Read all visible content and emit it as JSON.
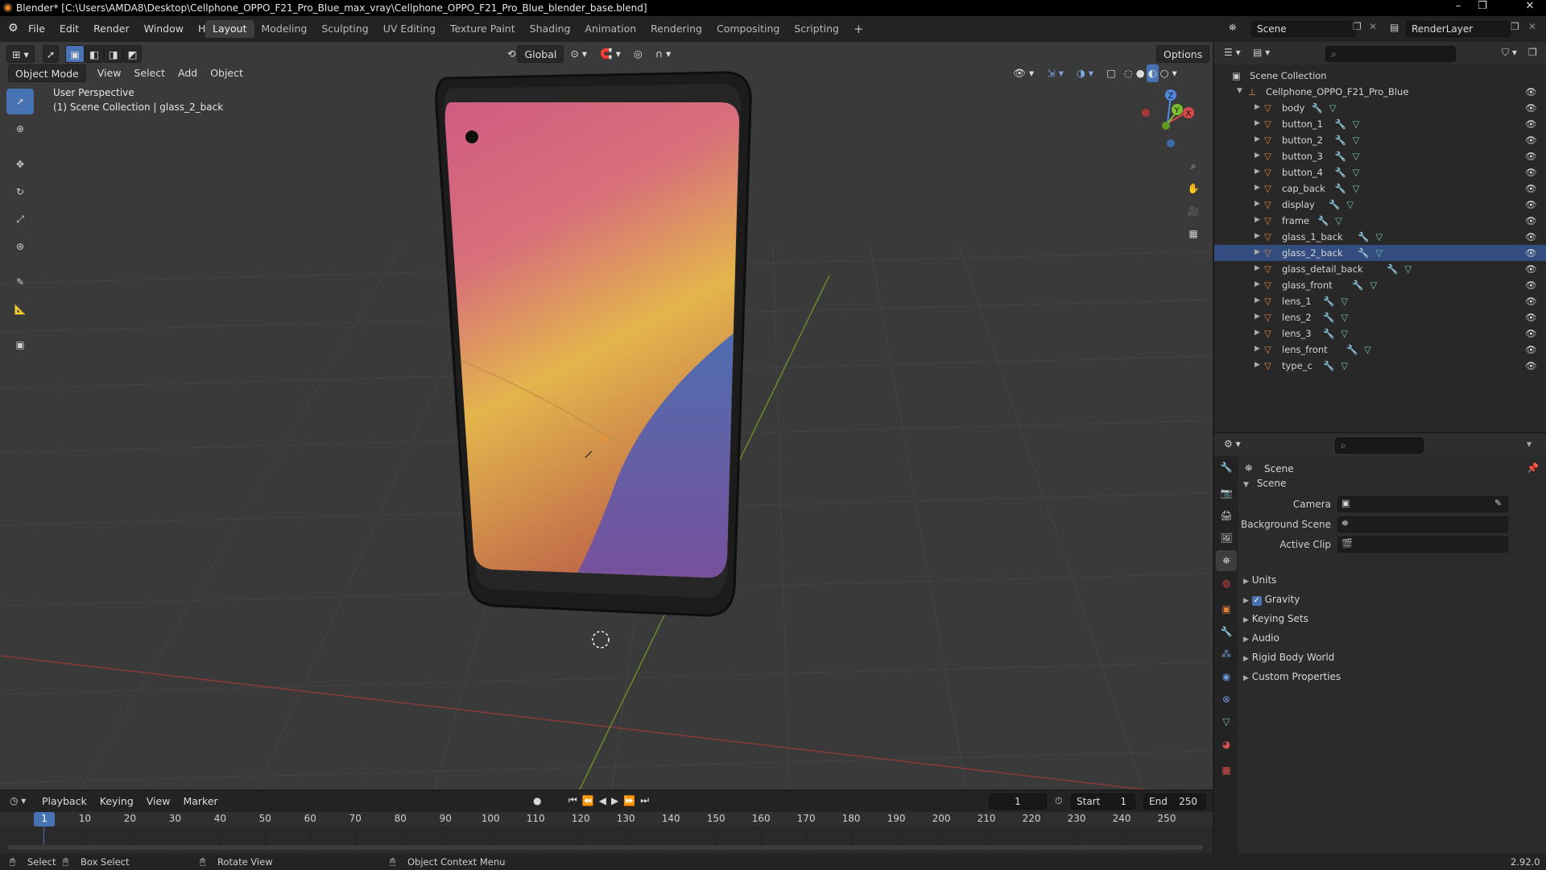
{
  "window": {
    "title": "Blender* [C:\\Users\\AMDA8\\Desktop\\Cellphone_OPPO_F21_Pro_Blue_max_vray\\Cellphone_OPPO_F21_Pro_Blue_blender_base.blend]"
  },
  "menu": [
    "File",
    "Edit",
    "Render",
    "Window",
    "Help"
  ],
  "workspaces": [
    "Layout",
    "Modeling",
    "Sculpting",
    "UV Editing",
    "Texture Paint",
    "Shading",
    "Animation",
    "Rendering",
    "Compositing",
    "Scripting"
  ],
  "scene_selector": {
    "scene": "Scene",
    "view_layer": "RenderLayer"
  },
  "viewport": {
    "mode": "Object Mode",
    "menus": [
      "View",
      "Select",
      "Add",
      "Object"
    ],
    "orientation": "Global",
    "options_label": "Options",
    "info_line1": "User Perspective",
    "info_line2": "(1) Scene Collection | glass_2_back"
  },
  "outliner": {
    "root": "Scene Collection",
    "collection": "Cellphone_OPPO_F21_Pro_Blue",
    "items": [
      "body",
      "button_1",
      "button_2",
      "button_3",
      "button_4",
      "cap_back",
      "display",
      "frame",
      "glass_1_back",
      "glass_2_back",
      "glass_detail_back",
      "glass_front",
      "lens_1",
      "lens_2",
      "lens_3",
      "lens_front",
      "type_c"
    ],
    "selected": "glass_2_back"
  },
  "properties": {
    "context": "Scene",
    "panel": "Scene",
    "camera_label": "Camera",
    "bg_scene_label": "Background Scene",
    "active_clip_label": "Active Clip",
    "subpanels": [
      "Units",
      "Gravity",
      "Keying Sets",
      "Audio",
      "Rigid Body World",
      "Custom Properties"
    ],
    "gravity_enabled": true
  },
  "timeline": {
    "menus": [
      "Playback",
      "Keying",
      "View",
      "Marker"
    ],
    "current_frame": "1",
    "start_label": "Start",
    "start": "1",
    "end_label": "End",
    "end": "250",
    "ticks": [
      "1",
      "10",
      "20",
      "30",
      "40",
      "50",
      "60",
      "70",
      "80",
      "90",
      "100",
      "110",
      "120",
      "130",
      "140",
      "150",
      "160",
      "170",
      "180",
      "190",
      "200",
      "210",
      "220",
      "230",
      "240",
      "250"
    ]
  },
  "status": {
    "select": "Select",
    "box_select": "Box Select",
    "rotate_view": "Rotate View",
    "context_menu": "Object Context Menu",
    "version": "2.92.0"
  },
  "colors": {
    "accent": "#4772b3",
    "header": "#232323",
    "viewport_bg": "#3a3a3a",
    "object_orange": "#e0833a",
    "mesh_green": "#6fc5a0"
  }
}
